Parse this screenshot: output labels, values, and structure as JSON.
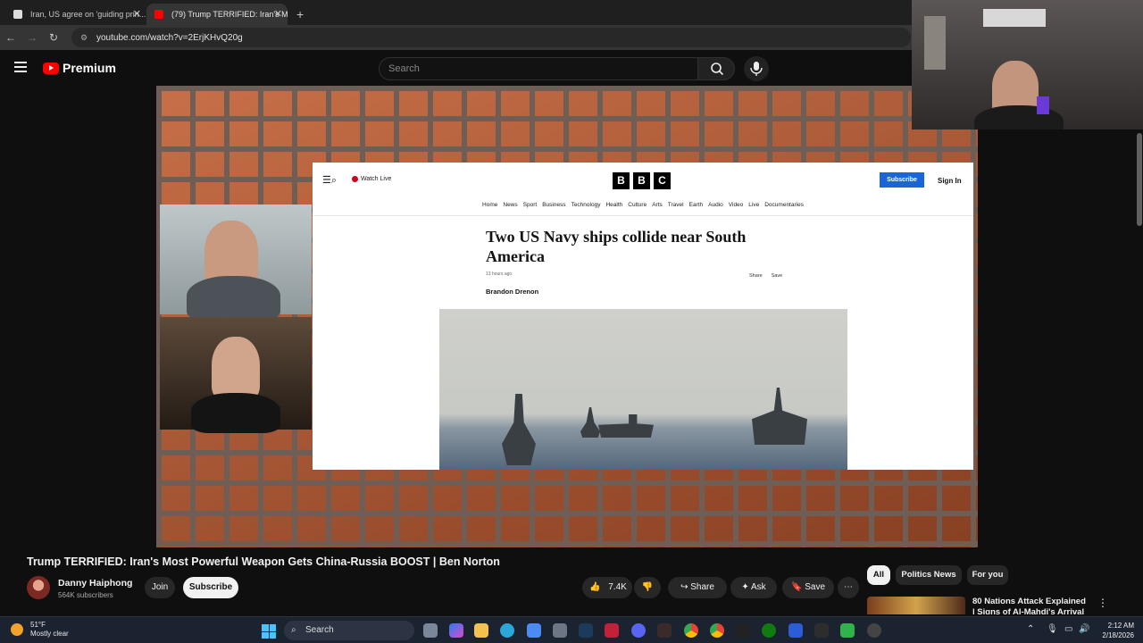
{
  "browser": {
    "tabs": [
      {
        "title": "Iran, US agree on 'guiding prin...",
        "active": false
      },
      {
        "title": "(79) Trump TERRIFIED: Iran's M...",
        "active": true
      }
    ],
    "new_tab": "+",
    "url": "youtube.com/watch?v=2ErjKHvQ20g"
  },
  "youtube": {
    "logo_text": "Premium",
    "search_placeholder": "Search"
  },
  "bbc": {
    "watch_live": "Watch Live",
    "logo": [
      "B",
      "B",
      "C"
    ],
    "subscribe": "Subscribe",
    "sign_in": "Sign In",
    "nav": [
      "Home",
      "News",
      "Sport",
      "Business",
      "Technology",
      "Health",
      "Culture",
      "Arts",
      "Travel",
      "Earth",
      "Audio",
      "Video",
      "Live",
      "Documentaries"
    ],
    "headline": "Two US Navy ships collide near South America",
    "time": "13 hours ago",
    "share": "Share",
    "save": "Save",
    "author": "Brandon Drenon"
  },
  "video": {
    "title": "Trump TERRIFIED: Iran's Most Powerful Weapon Gets China-Russia BOOST | Ben Norton",
    "channel": "Danny Haiphong",
    "subscribers": "564K subscribers",
    "join": "Join",
    "subscribe": "Subscribe",
    "likes": "7.4K",
    "share": "Share",
    "ask": "Ask",
    "save": "Save"
  },
  "chips": [
    "All",
    "Politics News",
    "For you"
  ],
  "recommendation": {
    "title": "80 Nations Attack Explained | Signs of Al-Mahdi's Arrival |"
  },
  "taskbar": {
    "temp": "51°F",
    "weather": "Mostly clear",
    "search": "Search",
    "time": "2:12 AM",
    "date": "2/18/2026"
  },
  "colors": {
    "yt_red": "#ff0000",
    "bbc_blue": "#1a66d6",
    "page_bg": "#0f0f0f"
  }
}
